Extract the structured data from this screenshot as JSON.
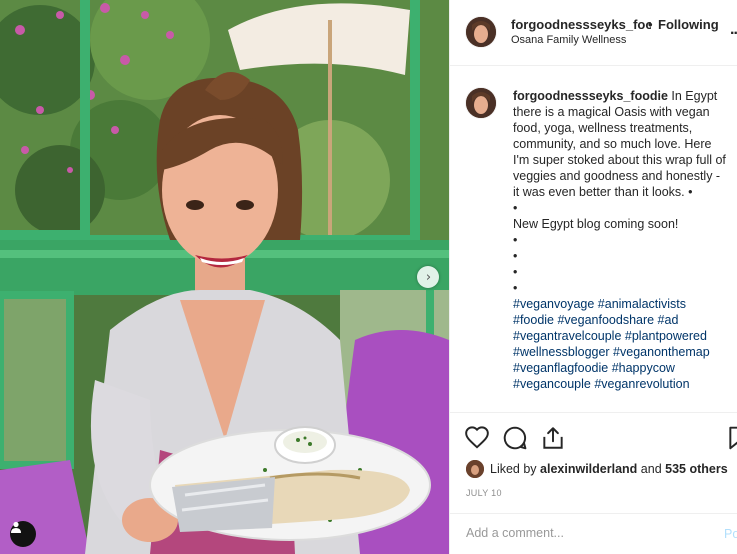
{
  "post": {
    "username": "forgoodnessseyks_foodie",
    "follow_separator": "•",
    "follow_status": "Following",
    "location": "Osana Family Wellness",
    "more_label": "..."
  },
  "caption": {
    "username": "forgoodnessseyks_foodie",
    "lines": [
      "In Egypt there is a magical Oasis with vegan food, yoga, wellness treatments, community, and so much love. Here I'm super stoked about this wrap full of veggies and goodness and honestly - it was even better than it looks. •",
      "•",
      "New Egypt blog coming soon!",
      "•",
      "•",
      "•",
      "•"
    ],
    "hashtags": "#veganvoyage #animalactivists #foodie #veganfoodshare #ad #vegantravelcouple #plantpowered #wellnessblogger #veganonthemap #veganflagfoodie #happycow #vegancouple #veganrevolution"
  },
  "likes": {
    "prefix": "Liked by",
    "liker": "alexinwilderland",
    "and": "and",
    "others": "535 others"
  },
  "date": "JULY 10",
  "comment": {
    "placeholder": "Add a comment...",
    "post_label": "Post"
  },
  "icons": {
    "like": "heart-icon",
    "comment": "comment-icon",
    "share": "share-icon",
    "save": "bookmark-icon",
    "next": "chevron-right-icon",
    "tags": "user-tag-icon"
  },
  "colors": {
    "hashtag": "#003569",
    "post_button": "#b2dffc",
    "meta": "#8e8e8e"
  }
}
